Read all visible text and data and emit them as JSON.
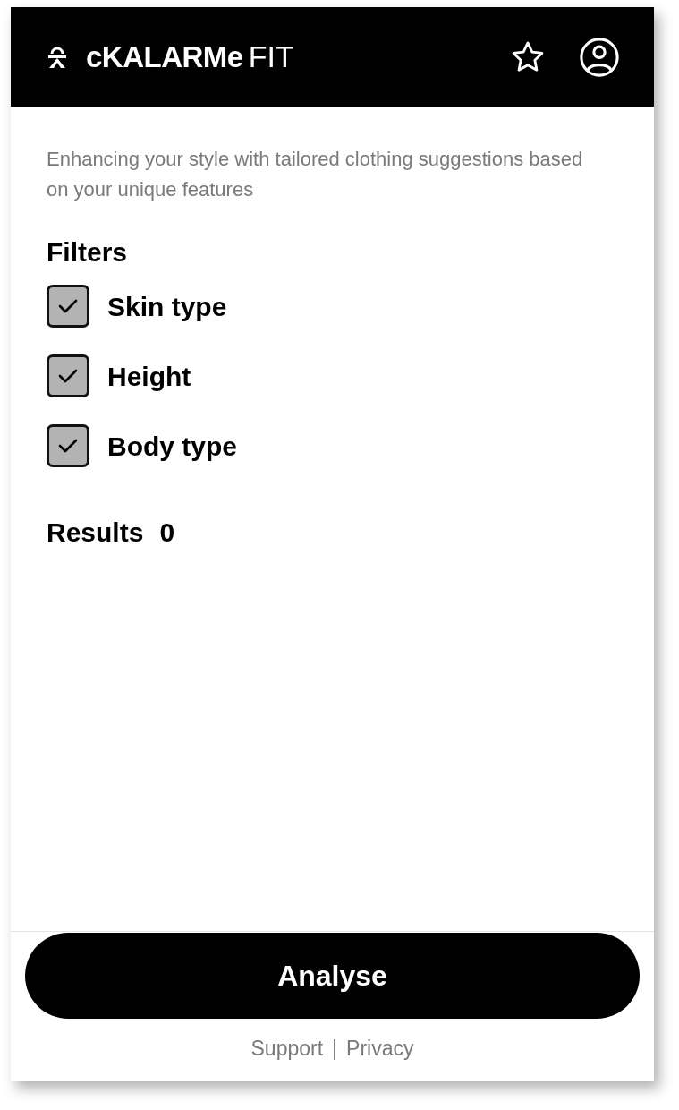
{
  "header": {
    "brand": "cKALARMe",
    "brand_suffix": "FIT"
  },
  "tagline": "Enhancing your style with tailored clothing suggestions based on your unique features",
  "filters": {
    "title": "Filters",
    "items": [
      {
        "label": "Skin type",
        "checked": true
      },
      {
        "label": "Height",
        "checked": true
      },
      {
        "label": "Body type",
        "checked": true
      }
    ]
  },
  "results": {
    "label": "Results",
    "count": "0"
  },
  "primary_button": "Analyse",
  "footer": {
    "links": [
      "Support",
      "Privacy"
    ],
    "separator": "|"
  }
}
